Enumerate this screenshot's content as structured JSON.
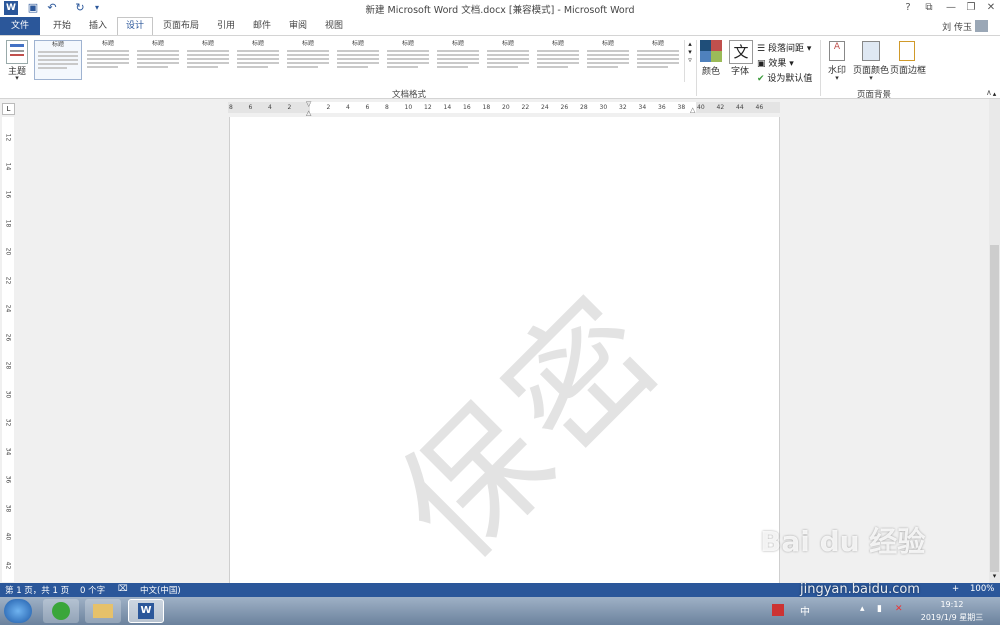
{
  "window": {
    "title": "新建 Microsoft Word 文档.docx [兼容模式] - Microsoft Word",
    "help": "?",
    "controls": [
      "—",
      "❐",
      "✕"
    ]
  },
  "quick_access": [
    "word-icon",
    "save-icon",
    "undo-icon",
    "redo-icon",
    "customize-icon"
  ],
  "tabs": [
    {
      "label": "文件"
    },
    {
      "label": "开始"
    },
    {
      "label": "插入"
    },
    {
      "label": "设计"
    },
    {
      "label": "页面布局"
    },
    {
      "label": "引用"
    },
    {
      "label": "邮件"
    },
    {
      "label": "审阅"
    },
    {
      "label": "视图"
    }
  ],
  "active_tab": "设计",
  "user": {
    "name": "刘 传玉"
  },
  "ribbon": {
    "theme_label": "主题",
    "gallery": {
      "group_label": "文档格式",
      "items": [
        "标题",
        "标题",
        "标题",
        "标题",
        "标题",
        "标题",
        "标题",
        "标题",
        "标题",
        "标题",
        "标题",
        "标题",
        "标题"
      ]
    },
    "colors_label": "颜色",
    "fonts_label": "字体",
    "fonts_glyph": "文",
    "paragraph_spacing_label": "段落间距",
    "effects_label": "效果",
    "set_default_label": "设为默认值",
    "watermark_label": "水印",
    "page_color_label": "页面颜色",
    "page_borders_label": "页面边框",
    "page_background_group": "页面背景"
  },
  "ruler": {
    "h_ticks": [
      "8",
      "6",
      "4",
      "2",
      "",
      "2",
      "4",
      "6",
      "8",
      "10",
      "12",
      "14",
      "16",
      "18",
      "20",
      "22",
      "24",
      "26",
      "28",
      "30",
      "32",
      "34",
      "36",
      "38",
      "40",
      "42",
      "44",
      "46"
    ],
    "v_ticks": [
      "12",
      "14",
      "16",
      "18",
      "20",
      "22",
      "24",
      "26",
      "28",
      "30",
      "32",
      "34",
      "36",
      "38",
      "40",
      "42"
    ]
  },
  "document": {
    "watermark_text": "保密"
  },
  "status": {
    "page": "第 1 页，共 1 页",
    "words": "0 个字",
    "language": "中文(中国)",
    "zoom": "100%"
  },
  "taskbar": {
    "time": "19:12",
    "date": "2019/1/9 星期三",
    "ime": "中"
  },
  "overlay": {
    "logo": "Bai du 经验",
    "url": "jingyan.baidu.com"
  },
  "colors": {
    "accent": "#2b579a"
  }
}
